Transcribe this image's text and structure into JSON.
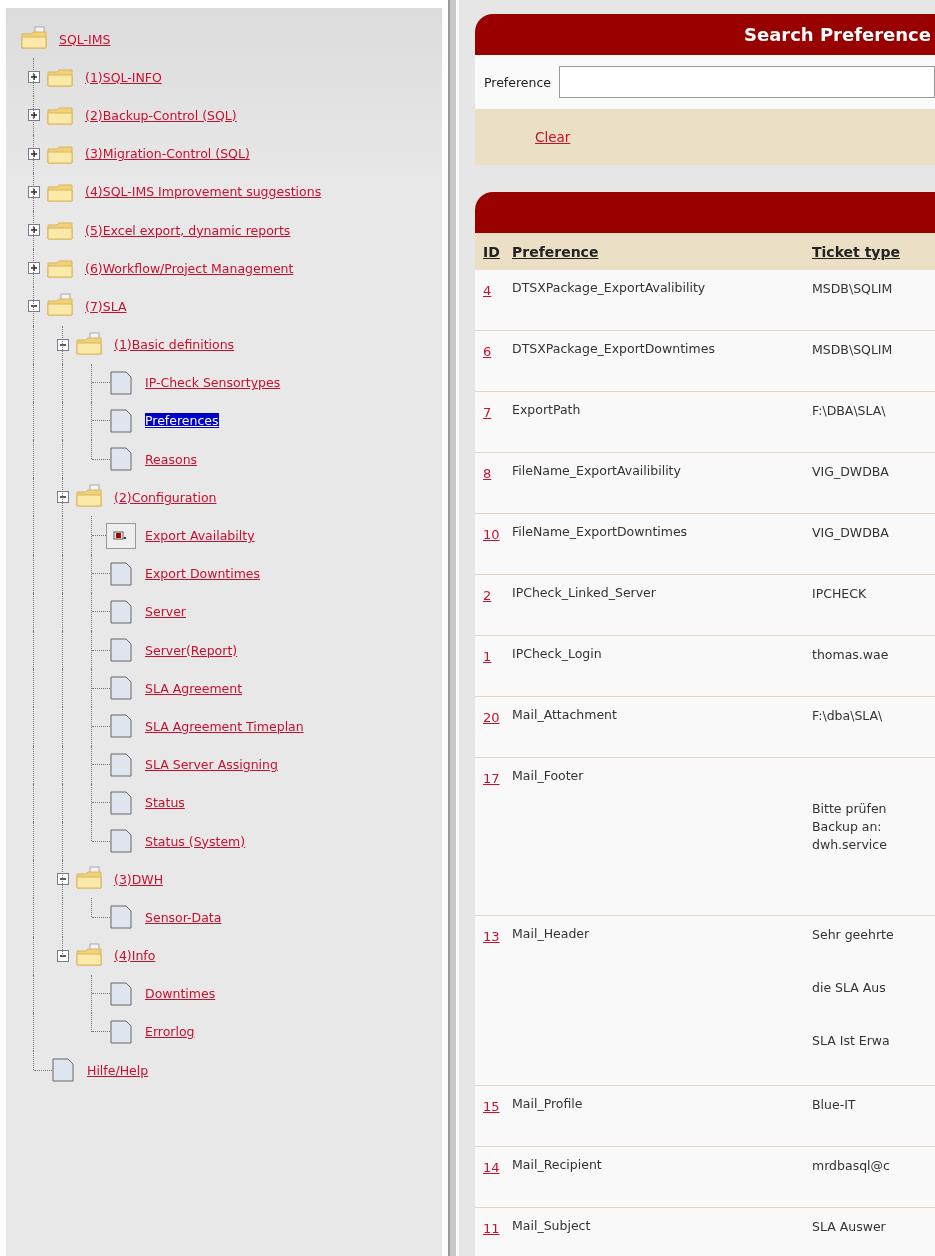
{
  "tree": {
    "label": "SQL-IMS",
    "kind": "folder",
    "selected": false,
    "children": [
      {
        "label": "(1)SQL-INFO",
        "kind": "folder",
        "expanded": false,
        "selected": false
      },
      {
        "label": "(2)Backup-Control (SQL)",
        "kind": "folder",
        "expanded": false,
        "selected": false
      },
      {
        "label": "(3)Migration-Control (SQL)",
        "kind": "folder",
        "expanded": false,
        "selected": false
      },
      {
        "label": "(4)SQL-IMS Improvement suggestions",
        "kind": "folder",
        "expanded": false,
        "selected": false
      },
      {
        "label": "(5)Excel export, dynamic reports",
        "kind": "folder",
        "expanded": false,
        "selected": false
      },
      {
        "label": "(6)Workflow/Project Management",
        "kind": "folder",
        "expanded": false,
        "selected": false
      },
      {
        "label": "(7)SLA",
        "kind": "folder",
        "expanded": true,
        "selected": false,
        "children": [
          {
            "label": "(1)Basic definitions",
            "kind": "folder",
            "expanded": true,
            "selected": false,
            "children": [
              {
                "label": "IP-Check Sensortypes",
                "kind": "page",
                "selected": false
              },
              {
                "label": "Preferences",
                "kind": "page",
                "selected": true
              },
              {
                "label": "Reasons",
                "kind": "page",
                "selected": false
              }
            ]
          },
          {
            "label": "(2)Configuration",
            "kind": "folder",
            "expanded": true,
            "selected": false,
            "children": [
              {
                "label": "Export Availabilty",
                "kind": "window",
                "selected": false
              },
              {
                "label": "Export Downtimes",
                "kind": "page",
                "selected": false
              },
              {
                "label": "Server",
                "kind": "page",
                "selected": false
              },
              {
                "label": "Server(Report)",
                "kind": "page",
                "selected": false
              },
              {
                "label": "SLA Agreement",
                "kind": "page",
                "selected": false
              },
              {
                "label": "SLA Agreement Timeplan",
                "kind": "page",
                "selected": false
              },
              {
                "label": "SLA Server Assigning",
                "kind": "page",
                "selected": false
              },
              {
                "label": "Status",
                "kind": "page",
                "selected": false
              },
              {
                "label": "Status (System)",
                "kind": "page",
                "selected": false
              }
            ]
          },
          {
            "label": "(3)DWH",
            "kind": "folder",
            "expanded": true,
            "selected": false,
            "children": [
              {
                "label": "Sensor-Data",
                "kind": "page",
                "selected": false
              }
            ]
          },
          {
            "label": "(4)Info",
            "kind": "folder",
            "expanded": true,
            "selected": false,
            "children": [
              {
                "label": "Downtimes",
                "kind": "page",
                "selected": false
              },
              {
                "label": "Errorlog",
                "kind": "page",
                "selected": false
              }
            ]
          }
        ]
      },
      {
        "label": "Hilfe/Help",
        "kind": "page",
        "selected": false
      }
    ]
  },
  "search": {
    "title": "Search Preference",
    "field_label": "Preference",
    "clear": "Clear"
  },
  "table": {
    "columns": [
      "ID",
      "Preference",
      "Ticket type"
    ],
    "rows": [
      {
        "id": "4",
        "preference": "DTSXPackage_ExportAvalibility",
        "value": [
          "MSDB\\SQLIM"
        ]
      },
      {
        "id": "6",
        "preference": "DTSXPackage_ExportDowntimes",
        "value": [
          "MSDB\\SQLIM"
        ]
      },
      {
        "id": "7",
        "preference": "ExportPath",
        "value": [
          "F:\\DBA\\SLA\\"
        ]
      },
      {
        "id": "8",
        "preference": "FileName_ExportAvailibility",
        "value": [
          "VIG_DWDBA"
        ]
      },
      {
        "id": "10",
        "preference": "FileName_ExportDowntimes",
        "value": [
          "VIG_DWDBA"
        ]
      },
      {
        "id": "2",
        "preference": "IPCheck_Linked_Server",
        "value": [
          "IPCHECK"
        ]
      },
      {
        "id": "1",
        "preference": "IPCheck_Login",
        "value": [
          "thomas.wae"
        ]
      },
      {
        "id": "20",
        "preference": "Mail_Attachment",
        "value": [
          "F:\\dba\\SLA\\"
        ]
      },
      {
        "id": "17",
        "preference": "Mail_Footer",
        "value": [
          "Bitte prüfen",
          "Backup an:",
          "dwh.service"
        ],
        "kind": "block"
      },
      {
        "id": "13",
        "preference": "Mail_Header",
        "value": [
          "Sehr geehrte",
          "die SLA Aus",
          "SLA Ist Erwa"
        ],
        "kind": "paragraphs"
      },
      {
        "id": "15",
        "preference": "Mail_Profile",
        "value": [
          "Blue-IT"
        ]
      },
      {
        "id": "14",
        "preference": "Mail_Recipient",
        "value": [
          "mrdbasql@c"
        ]
      },
      {
        "id": "11",
        "preference": "Mail_Subject",
        "value": [
          "SLA Auswer"
        ]
      }
    ]
  }
}
